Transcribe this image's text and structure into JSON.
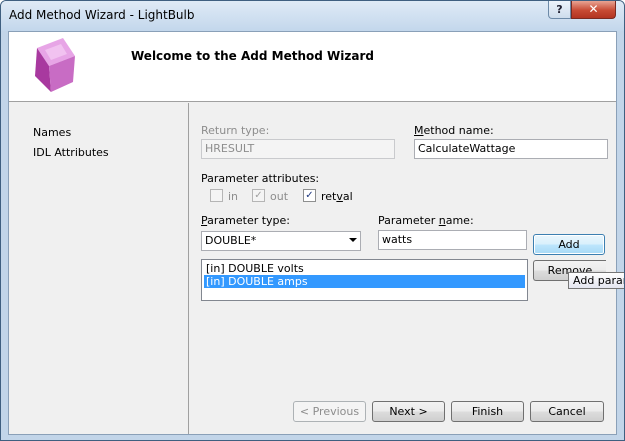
{
  "window": {
    "title": "Add Method Wizard - LightBulb",
    "help_label": "?",
    "close_label": "✕"
  },
  "banner": {
    "title": "Welcome to the Add Method Wizard",
    "logo_icon": "purple-cube-icon"
  },
  "nav": {
    "items": [
      {
        "label": "Names"
      },
      {
        "label": "IDL Attributes"
      }
    ]
  },
  "form": {
    "return_type_label": "Return type:",
    "return_type_value": "HRESULT",
    "method_name_label_pre": "",
    "method_name_label_u": "M",
    "method_name_label_post": "ethod name:",
    "method_name_value": "CalculateWattage",
    "param_attrs_label": "Parameter attributes:",
    "attr_in_label": "in",
    "attr_in_checked": false,
    "attr_out_label": "out",
    "attr_out_checked": true,
    "attr_retval_label_pre": "ret",
    "attr_retval_label_u": "v",
    "attr_retval_label_post": "al",
    "attr_retval_checked": true,
    "param_type_label_pre": "",
    "param_type_label_u": "P",
    "param_type_label_post": "arameter type:",
    "param_type_value": "DOUBLE*",
    "param_name_label_pre": "Parameter ",
    "param_name_label_u": "n",
    "param_name_label_post": "ame:",
    "param_name_value": "watts",
    "add_button": "Add",
    "remove_button": "Remove",
    "tooltip": "Add parameter",
    "params": [
      {
        "text": "[in] DOUBLE volts",
        "selected": false
      },
      {
        "text": "[in] DOUBLE amps",
        "selected": true
      }
    ]
  },
  "footer": {
    "previous": "< Previous",
    "next": "Next >",
    "finish": "Finish",
    "cancel": "Cancel"
  },
  "colors": {
    "selection": "#3399ff",
    "title_bar": "#c3d7ec",
    "close_button": "#c74a34",
    "cube": "#c86cc4"
  }
}
